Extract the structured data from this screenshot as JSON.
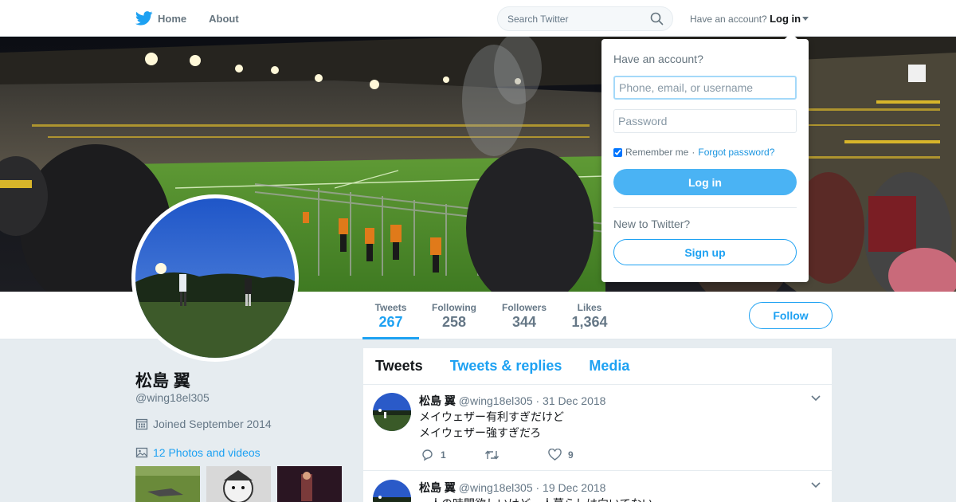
{
  "nav": {
    "home_label": "Home",
    "about_label": "About",
    "search_placeholder": "Search Twitter",
    "have_account": "Have an account?",
    "login_label": "Log in"
  },
  "profile_nav": {
    "stats": [
      {
        "label": "Tweets",
        "value": "267"
      },
      {
        "label": "Following",
        "value": "258"
      },
      {
        "label": "Followers",
        "value": "344"
      },
      {
        "label": "Likes",
        "value": "1,364"
      }
    ],
    "follow_label": "Follow"
  },
  "profile": {
    "name": "松島 翼",
    "handle": "@wing18el305",
    "joined": "Joined September 2014",
    "photos_link": "12 Photos and videos"
  },
  "timeline": {
    "tabs": [
      "Tweets",
      "Tweets & replies",
      "Media"
    ],
    "tweets": [
      {
        "name": "松島 翼",
        "meta": "@wing18el305 · 31 Dec 2018",
        "lines": [
          "メイウェザー有利すぎだけど",
          "メイウェザー強すぎだろ"
        ],
        "replies": "1",
        "retweets": "",
        "likes": "9"
      },
      {
        "name": "松島 翼",
        "meta": "@wing18el305 · 19 Dec 2018",
        "lines": [
          "一人の時間欲しいけど一人暮らしは向いてない"
        ],
        "replies": "",
        "retweets": "",
        "likes": ""
      }
    ]
  },
  "login_dropdown": {
    "title": "Have an account?",
    "username_placeholder": "Phone, email, or username",
    "password_placeholder": "Password",
    "remember_label": "Remember me",
    "separator": "·",
    "forgot_label": "Forgot password?",
    "login_button": "Log in",
    "new_label": "New to Twitter?",
    "signup_button": "Sign up"
  },
  "colors": {
    "brand": "#1da1f2",
    "login_button": "#4ab3f4",
    "background": "#e6ecf0"
  }
}
